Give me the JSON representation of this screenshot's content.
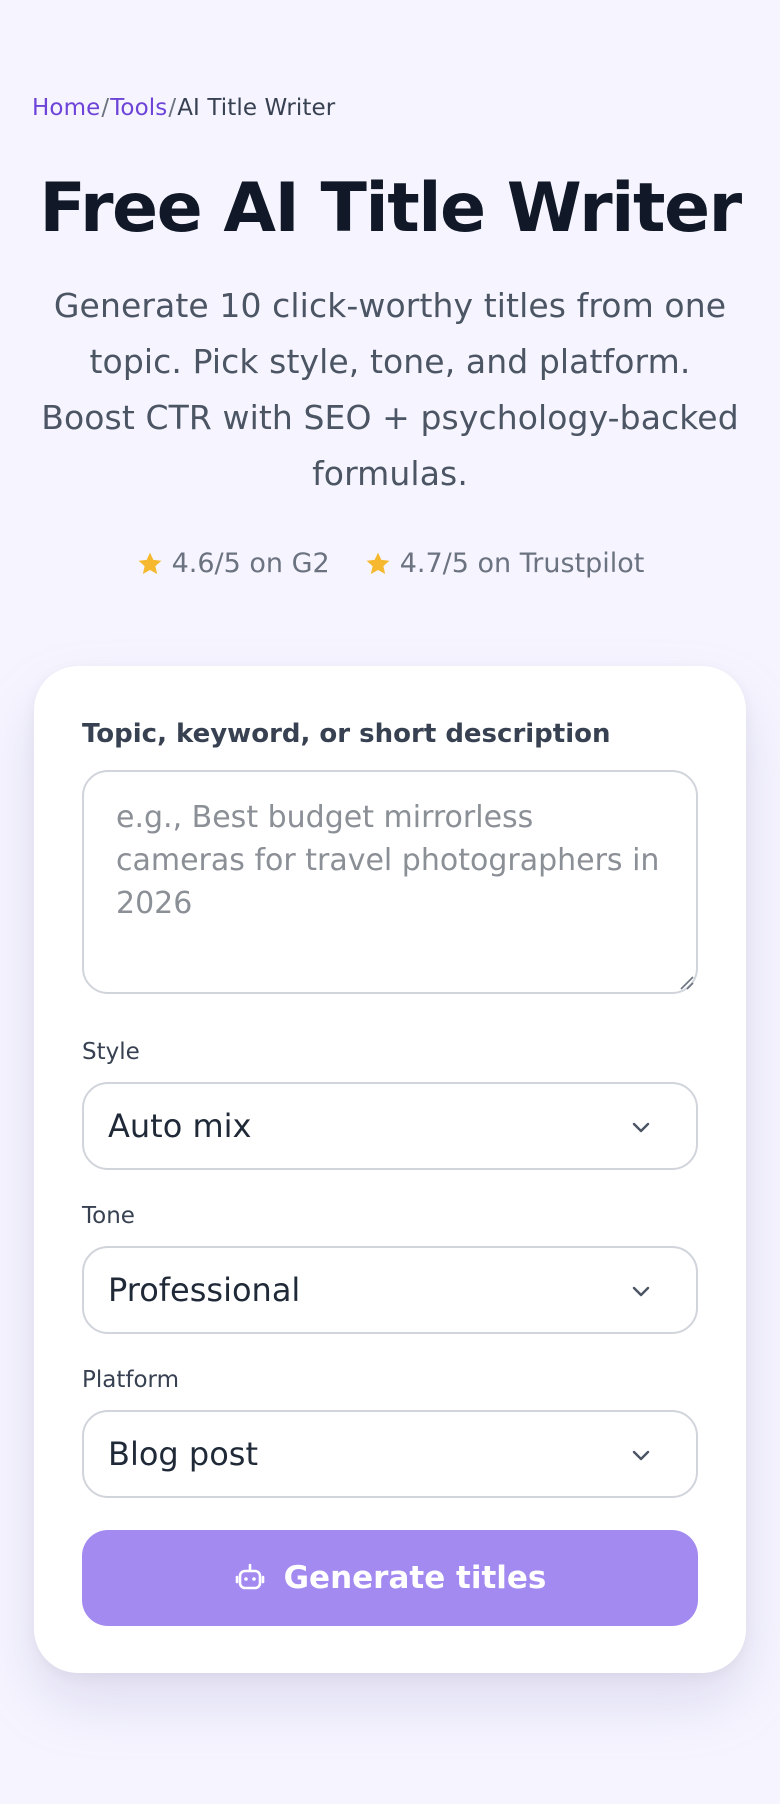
{
  "breadcrumb": {
    "home": "Home",
    "tools": "Tools",
    "current": "AI Title Writer",
    "separator": "/"
  },
  "hero": {
    "title": "Free AI Title Writer",
    "subtitle": "Generate 10 click-worthy titles from one topic. Pick style, tone, and platform. Boost CTR with SEO + psychology-backed formulas."
  },
  "ratings": [
    {
      "icon": "star-icon",
      "text": "4.6/5 on G2"
    },
    {
      "icon": "star-icon",
      "text": "4.7/5 on Trustpilot"
    }
  ],
  "form": {
    "topic_label": "Topic, keyword, or short description",
    "topic_value": "",
    "topic_placeholder": "e.g., Best budget mirrorless cameras for travel photographers in 2026",
    "style_label": "Style",
    "style_value": "Auto mix",
    "tone_label": "Tone",
    "tone_value": "Professional",
    "platform_label": "Platform",
    "platform_value": "Blog post",
    "generate_label": "Generate titles"
  },
  "colors": {
    "accent": "#6d43d8",
    "button": "#a38af0",
    "star": "#f5b82e",
    "background": "#f6f5ff"
  }
}
